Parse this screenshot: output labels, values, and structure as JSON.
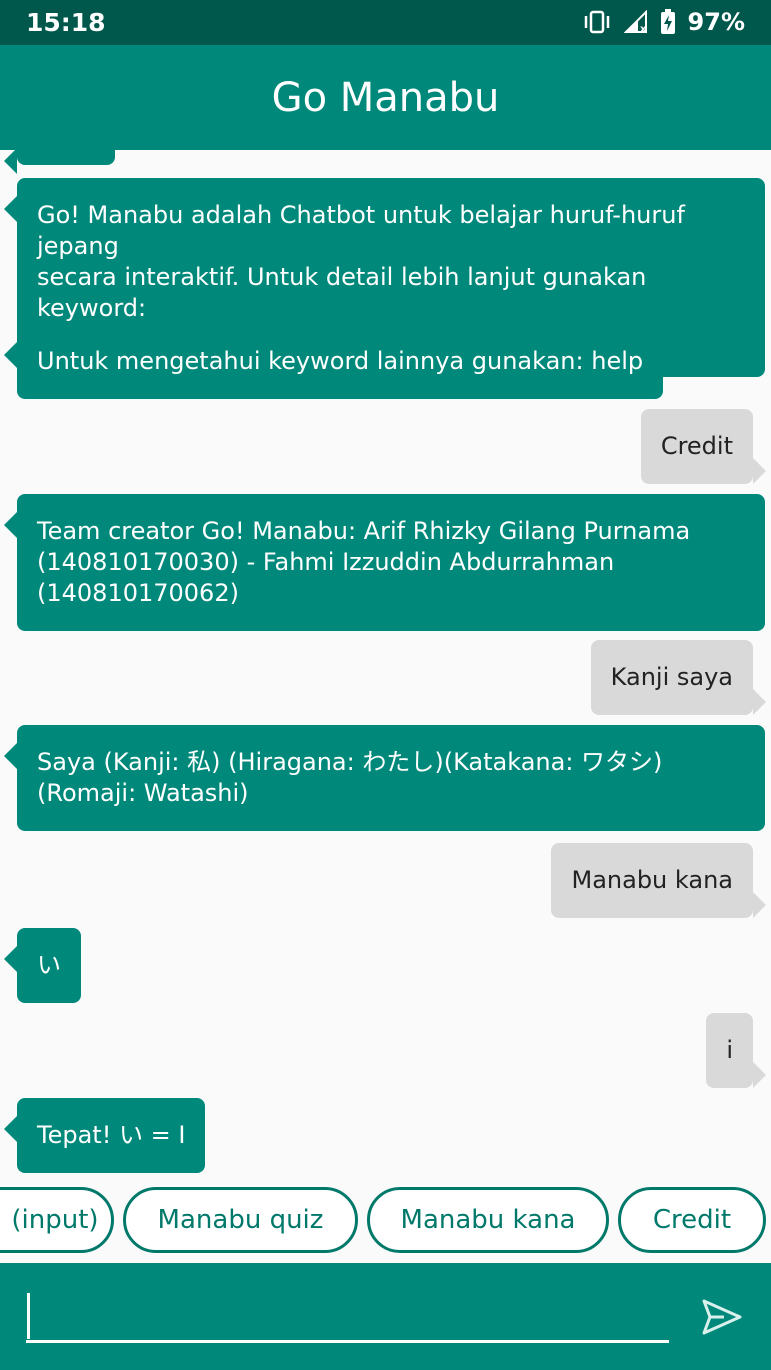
{
  "status": {
    "time": "15:18",
    "battery": "97%"
  },
  "app": {
    "title": "Go Manabu"
  },
  "messages": [
    {
      "sender": "bot",
      "text": ""
    },
    {
      "sender": "bot",
      "text": "Go! Manabu adalah Chatbot untuk belajar huruf-huruf jepang\nsecara interaktif. Untuk detail lebih lanjut gunakan keyword:\nhelp"
    },
    {
      "sender": "bot",
      "text": "Untuk mengetahui keyword lainnya gunakan: help"
    },
    {
      "sender": "user",
      "text": "Credit"
    },
    {
      "sender": "bot",
      "text": "Team creator Go! Manabu: Arif Rhizky Gilang Purnama\n(140810170030) - Fahmi Izzuddin Abdurrahman\n(140810170062)"
    },
    {
      "sender": "user",
      "text": "Kanji saya"
    },
    {
      "sender": "bot",
      "text": "Saya (Kanji: 私) (Hiragana: わたし)(Katakana: ワタシ)\n(Romaji: Watashi)"
    },
    {
      "sender": "user",
      "text": "Manabu kana"
    },
    {
      "sender": "bot",
      "text": "い"
    },
    {
      "sender": "user",
      "text": "i"
    },
    {
      "sender": "bot",
      "text": "Tepat! い = I"
    }
  ],
  "chips": [
    "(input)",
    "Manabu quiz",
    "Manabu kana",
    "Credit"
  ],
  "input": {
    "value": "",
    "placeholder": ""
  },
  "colors": {
    "primary": "#00897b",
    "primary_dark": "#00574b",
    "user_bubble": "#d9d9d9"
  },
  "icons": {
    "vibrate": "vibrate-icon",
    "signal": "signal-icon",
    "battery": "battery-charging-icon",
    "send": "send-icon"
  }
}
